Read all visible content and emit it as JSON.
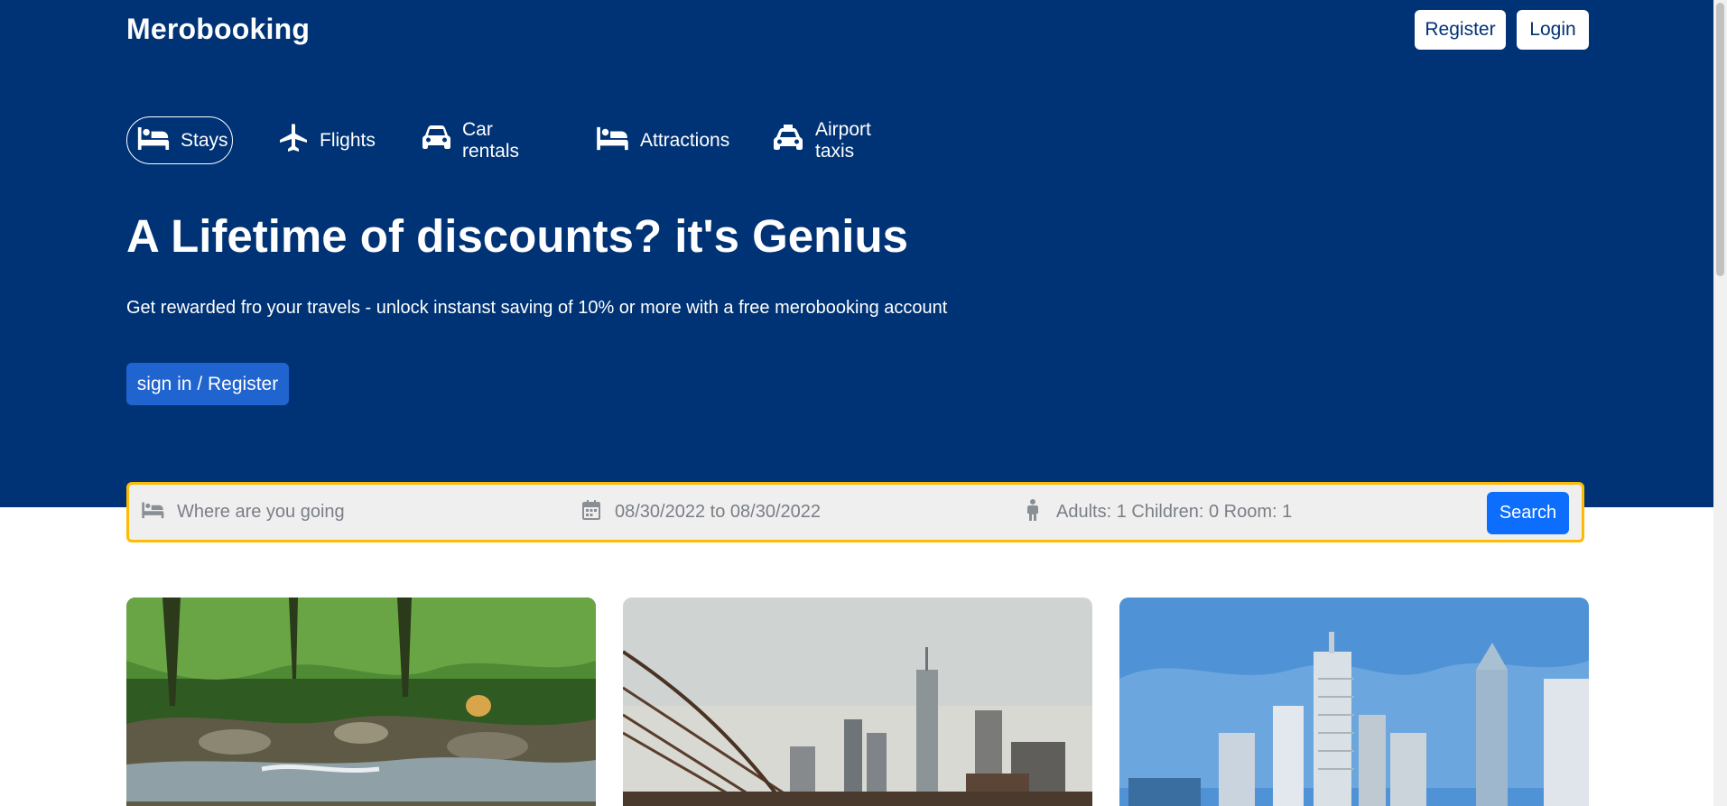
{
  "header": {
    "brand": "Merobooking",
    "register_label": "Register",
    "login_label": "Login"
  },
  "nav": {
    "items": [
      {
        "label": "Stays",
        "icon": "bed-icon",
        "active": true
      },
      {
        "label": "Flights",
        "icon": "plane-icon",
        "active": false
      },
      {
        "label": "Car rentals",
        "icon": "car-icon",
        "active": false
      },
      {
        "label": "Attractions",
        "icon": "bed-icon",
        "active": false
      },
      {
        "label": "Airport taxis",
        "icon": "taxi-icon",
        "active": false
      }
    ]
  },
  "hero": {
    "title": "A Lifetime of discounts? it's Genius",
    "subtitle": "Get rewarded fro your travels - unlock instanst saving of 10% or more with a free merobooking account",
    "cta_label": "sign in / Register"
  },
  "search": {
    "destination_placeholder": "Where are you going",
    "date_range": "08/30/2022 to 08/30/2022",
    "guests": "Adults: 1 Children: 0 Room: 1",
    "button_label": "Search"
  },
  "colors": {
    "hero_bg": "#003375",
    "accent_blue": "#0d6efd",
    "search_border": "#febb02"
  },
  "cards": [
    {
      "image": "forest-stream-photo"
    },
    {
      "image": "bridge-skyline-photo"
    },
    {
      "image": "city-towers-photo"
    }
  ]
}
